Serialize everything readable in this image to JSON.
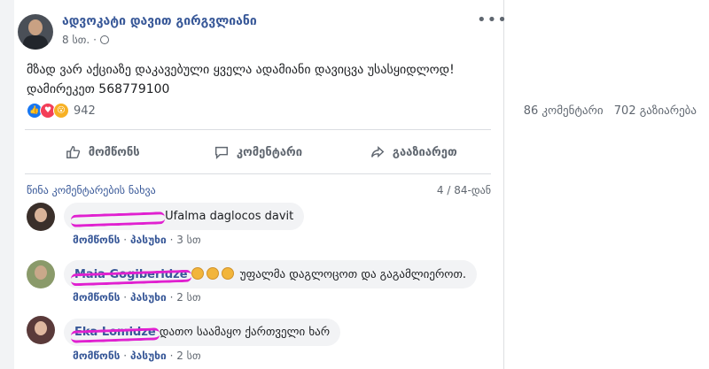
{
  "post": {
    "author": "ადვოკატი დავით გირგვლიანი",
    "time": "8 სთ.",
    "separator": "·",
    "text_line1": "მზად ვარ აქციაზე დაკავებული ყველა ადამიანი დავიცვა უსასყიდლოდ!",
    "text_line2": "დამირეკეთ 568779100",
    "more": "•••",
    "reaction_count": "942",
    "comments_stat": "86 კომენტარი",
    "shares_stat": "702 გაზიარება"
  },
  "actions": {
    "like": "მომწონს",
    "comment": "კომენტარი",
    "share": "გააზიარეთ"
  },
  "comments_header": {
    "prev_link": "წინა კომენტარების ნახვა",
    "count": "4 / 84-დან"
  },
  "comments": [
    {
      "text": "Ufalma daglocos davit",
      "like": "მომწონს",
      "reply": "პასუხი",
      "time": "3 სთ"
    },
    {
      "name": "Maia Gogiberidze",
      "text": "უფალმა დაგლოცოთ და გაგამლიეროთ.",
      "like": "მომწონს",
      "reply": "პასუხი",
      "time": "2 სთ"
    },
    {
      "name": "Eka Lomidze",
      "text": "დათო საამაყო ქართველი ხარ",
      "like": "მომწონს",
      "reply": "პასუხი",
      "time": "2 სთ"
    }
  ],
  "meta_sep": "·",
  "colors": {
    "link": "#385898",
    "redaction": "#e020d0",
    "like_blue": "#1877f2"
  }
}
